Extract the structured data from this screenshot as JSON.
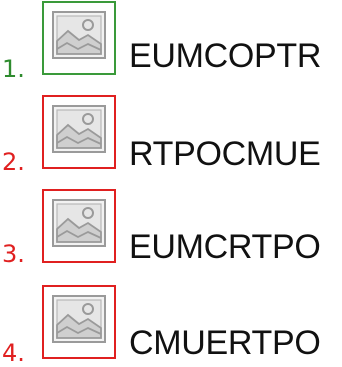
{
  "options": [
    {
      "number": "1.",
      "word": "EUMCOPTR",
      "frame_color": "#3a9a3a",
      "number_color": "#2e8b2e",
      "state": "correct"
    },
    {
      "number": "2.",
      "word": "RTPOCMUE",
      "frame_color": "#e02020",
      "number_color": "#e02020",
      "state": "incorrect"
    },
    {
      "number": "3.",
      "word": "EUMCRTPO",
      "frame_color": "#e02020",
      "number_color": "#e02020",
      "state": "incorrect"
    },
    {
      "number": "4.",
      "word": "CMUERTPO",
      "frame_color": "#e02020",
      "number_color": "#e02020",
      "state": "incorrect"
    }
  ],
  "icon": "image-placeholder-icon"
}
